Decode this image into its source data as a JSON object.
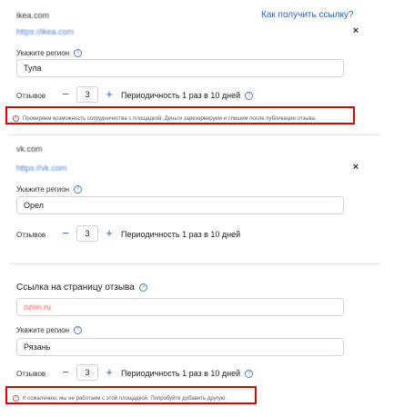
{
  "block1": {
    "domain": "ikea.com",
    "url": "https://ikea.com",
    "help_link": "Как получить ссылку?",
    "region_label": "Укажите регион",
    "region_value": "Тула",
    "reviews_label": "Отзывов",
    "minus": "−",
    "count": "3",
    "plus": "+",
    "period": "Периодичность 1 раз в 10 дней",
    "notice": "Проверяем возможность сотрудничества с площадкой. Деньги зарезервируем и спишем после публикации отзыва."
  },
  "block2": {
    "domain": "vk.com",
    "url": "https://vk.com",
    "region_label": "Укажите регион",
    "region_value": "Орел",
    "reviews_label": "Отзывов",
    "minus": "−",
    "count": "3",
    "plus": "+",
    "period": "Периодичность 1 раз в 10 дней"
  },
  "block3": {
    "link_label": "Ссылка на страницу отзыва",
    "link_value": "ozon.ru",
    "region_label": "Укажите регион",
    "region_value": "Рязань",
    "reviews_label": "Отзывов",
    "minus": "−",
    "count": "3",
    "plus": "+",
    "period": "Периодичность 1 раз в 10 дней",
    "notice": "К сожалению, мы не работаем с этой площадкой. Попробуйте добавить другую."
  },
  "icons": {
    "question": "?",
    "close": "×",
    "info": "i"
  },
  "colors": {
    "accent": "#2a63c4",
    "warning_border": "#e00000",
    "input_border": "#cfd4da"
  }
}
